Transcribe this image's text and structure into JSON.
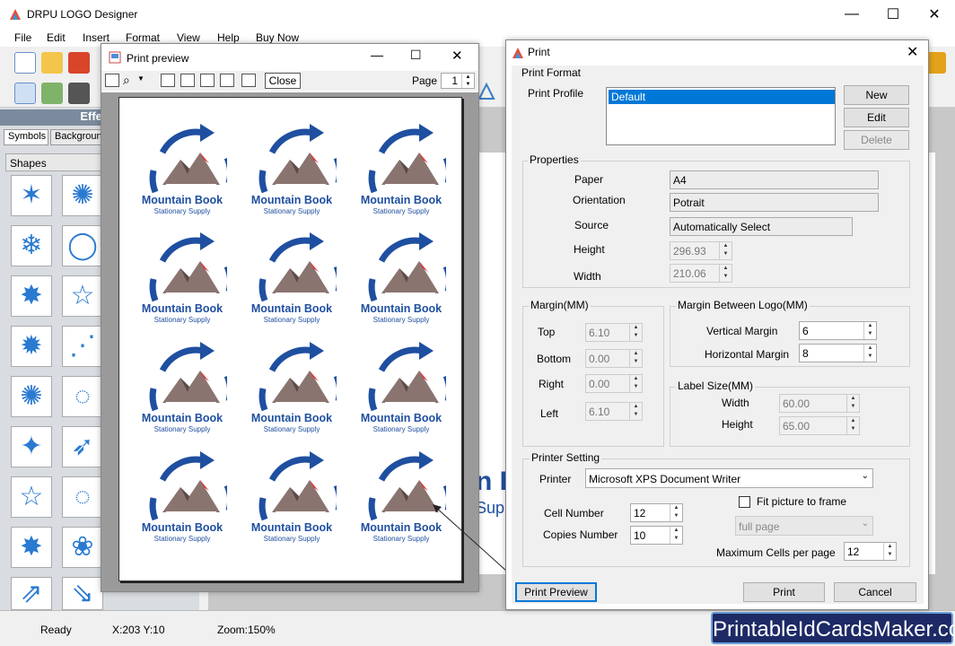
{
  "app": {
    "title": "DRPU LOGO Designer",
    "win_controls": [
      "—",
      "☐",
      "✕"
    ]
  },
  "menu": [
    "File",
    "Edit",
    "Insert",
    "Format",
    "View",
    "Help",
    "Buy Now"
  ],
  "left_panel": {
    "header": "Effects",
    "tabs": [
      "Symbols",
      "Backgroun"
    ],
    "shapes_label": "Shapes"
  },
  "status": {
    "ready": "Ready",
    "coords": "X:203  Y:10",
    "zoom": "Zoom:150%"
  },
  "brand": "PrintableIdCardsMaker.com",
  "canvas_text": {
    "big_letters": "n E",
    "supp": "Supp"
  },
  "preview": {
    "title": "Print preview",
    "close_label": "Close",
    "page_label": "Page",
    "page_value": "1",
    "logo_name": "Mountain Book",
    "logo_sub": "Stationary Supply",
    "cells": 12,
    "partial_last_name": "Mountain Book",
    "partial_last_sub": "Stationary Supply"
  },
  "print": {
    "title": "Print",
    "format": {
      "group": "Print Format",
      "profile_label": "Print Profile",
      "profile_selected": "Default",
      "new": "New",
      "edit": "Edit",
      "delete": "Delete"
    },
    "properties": {
      "group": "Properties",
      "paper_label": "Paper",
      "paper": "A4",
      "orientation_label": "Orientation",
      "orientation": "Potrait",
      "source_label": "Source",
      "source": "Automatically Select",
      "height_label": "Height",
      "height": "296.93",
      "width_label": "Width",
      "width": "210.06"
    },
    "margin": {
      "group": "Margin(MM)",
      "top_label": "Top",
      "top": "6.10",
      "bottom_label": "Bottom",
      "bottom": "0.00",
      "right_label": "Right",
      "right": "0.00",
      "left_label": "Left",
      "left": "6.10"
    },
    "between": {
      "group": "Margin Between Logo(MM)",
      "vertical_label": "Vertical Margin",
      "vertical": "6",
      "horizontal_label": "Horizontal Margin",
      "horizontal": "8"
    },
    "label_size": {
      "group": "Label Size(MM)",
      "width_label": "Width",
      "width": "60.00",
      "height_label": "Height",
      "height": "65.00"
    },
    "printer": {
      "group": "Printer Setting",
      "printer_label": "Printer",
      "printer": "Microsoft XPS Document Writer",
      "fit_label": "Fit picture to frame",
      "fit_checked": false,
      "fit_mode": "full page",
      "cell_label": "Cell Number",
      "cell": "12",
      "copies_label": "Copies Number",
      "copies": "10",
      "max_label": "Maximum Cells per page",
      "max": "12"
    },
    "buttons": {
      "preview": "Print Preview",
      "print": "Print",
      "cancel": "Cancel"
    }
  },
  "colors": {
    "logo_blue": "#1f4fa0",
    "selection": "#0078d7",
    "brand_bg": "#1d2a66"
  }
}
